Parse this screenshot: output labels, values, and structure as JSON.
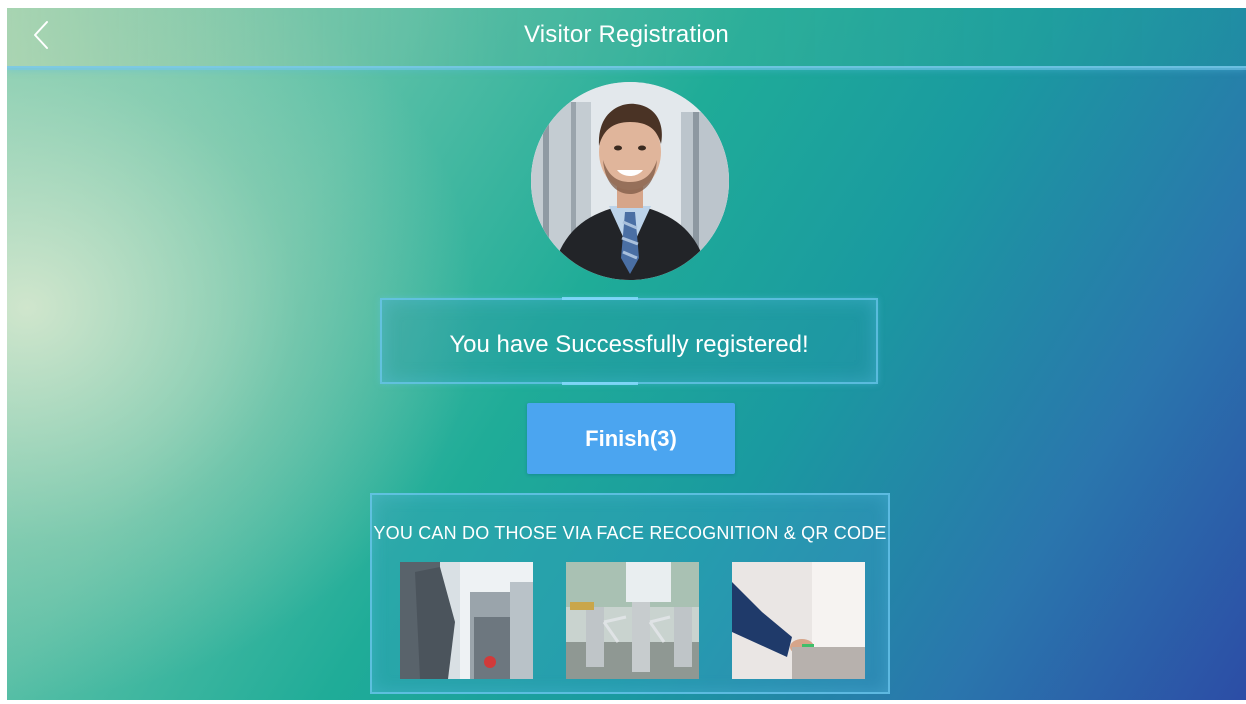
{
  "header": {
    "title": "Visitor Registration",
    "back_icon": "chevron-left-icon"
  },
  "avatar": {
    "alt": "registered visitor photo"
  },
  "message": {
    "text": "You have Successfully registered!"
  },
  "finish_button": {
    "label": "Finish(3)"
  },
  "info": {
    "text": "YOU CAN DO THOSE VIA FACE RECOGNITION & QR CODE",
    "thumbnails": [
      {
        "name": "turnstile-entry-image"
      },
      {
        "name": "tripod-turnstile-image"
      },
      {
        "name": "card-reader-image"
      }
    ]
  },
  "colors": {
    "button": "#4ba5f0",
    "border_glow": "#6ec8f0",
    "text": "#ffffff"
  }
}
